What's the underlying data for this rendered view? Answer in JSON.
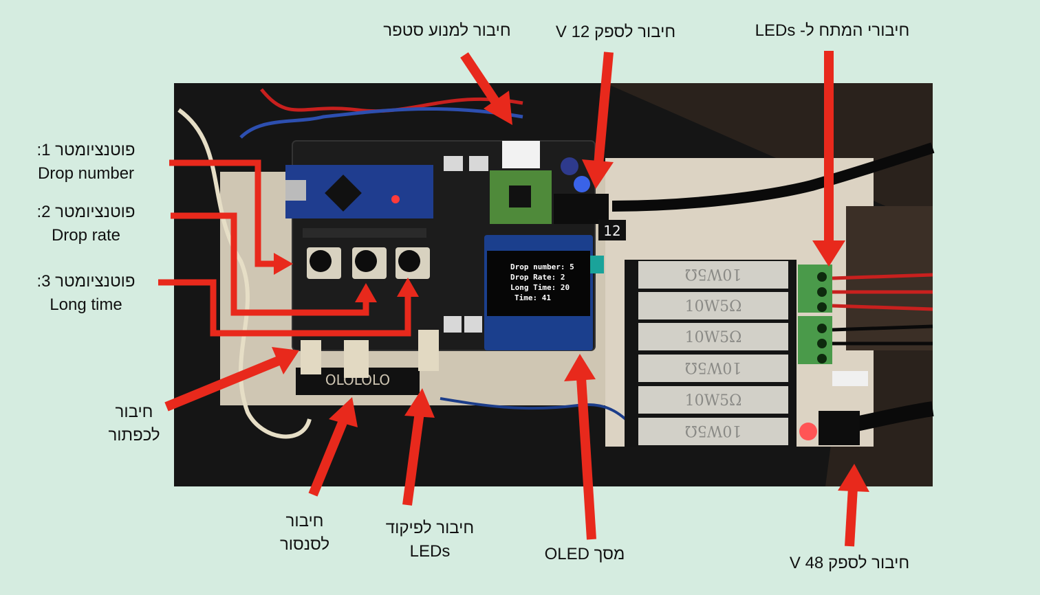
{
  "labels": {
    "pot1_he": "פוטנציומטר 1:",
    "pot1_en": "Drop number",
    "pot2_he": "פוטנציומטר 2:",
    "pot2_en": "Drop rate",
    "pot3_he": "פוטנציומטר 3:",
    "pot3_en": "Long time",
    "stepper": "חיבור למנוע סטפר",
    "psu12": "חיבור לספק 12 V",
    "leds_switch": "חיבורי המתח ל- LEDs",
    "button_l1": "חיבור",
    "button_l2": "לכפתור",
    "sensor_l1": "חיבור",
    "sensor_l2": "לסנסור",
    "ledctrl_l1": "חיבור לפיקוד",
    "ledctrl_l2": "LEDs",
    "oled": "מסך OLED",
    "psu48": "חיבור לספק 48 V"
  },
  "oled_screen": {
    "line1": "Drop number: 5",
    "line2": "Drop Rate: 2",
    "line3": "Long Time: 20",
    "line4": "Time: 41"
  },
  "resistor_marking": "10W5Ω",
  "connector_label": "12",
  "colors": {
    "background": "#d5ece0",
    "arrow": "#e8291c",
    "photo_dark": "#151515",
    "pcb": "#1c1c1c",
    "arduino": "#1f3d8f"
  }
}
